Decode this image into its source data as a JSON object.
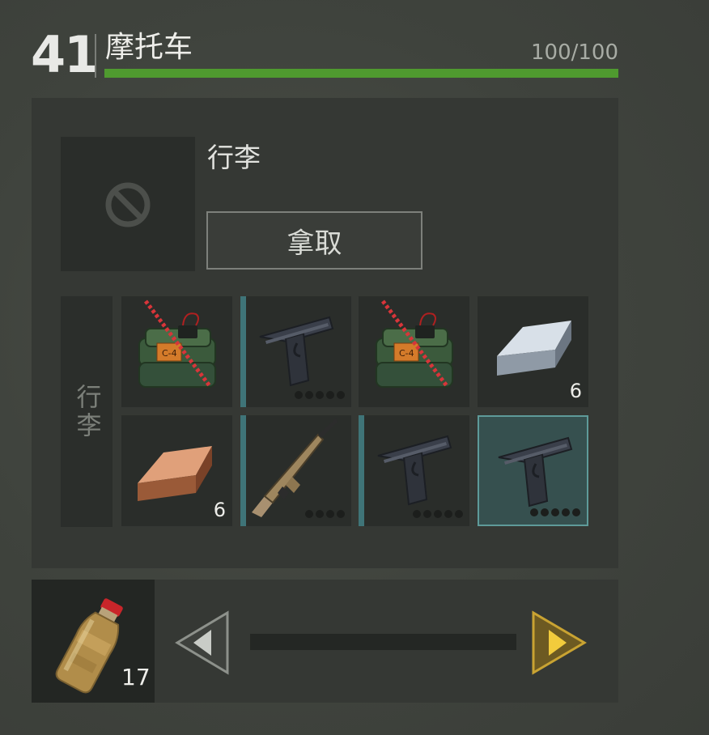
{
  "header": {
    "level": "41",
    "vehicle_name": "摩托车",
    "durability_text": "100/100",
    "durability_fraction": 1.0,
    "durability_color": "#4f9a2f"
  },
  "storage": {
    "slot_icon": "blocked-icon",
    "title": "行李",
    "take_label": "拿取",
    "side_label": "行李"
  },
  "items": [
    {
      "name": "c4-explosive",
      "icon": "c4-icon",
      "crossed": true,
      "count": "",
      "dots": 0,
      "bar": false,
      "selected": false
    },
    {
      "name": "pistol",
      "icon": "pistol-icon",
      "crossed": false,
      "count": "",
      "dots": 5,
      "bar": true,
      "selected": false
    },
    {
      "name": "c4-explosive",
      "icon": "c4-icon",
      "crossed": true,
      "count": "",
      "dots": 0,
      "bar": false,
      "selected": false
    },
    {
      "name": "iron-ingot",
      "icon": "iron-ingot-icon",
      "crossed": false,
      "count": "6",
      "dots": 0,
      "bar": false,
      "selected": false
    },
    {
      "name": "copper-ingot",
      "icon": "copper-ingot-icon",
      "crossed": false,
      "count": "6",
      "dots": 0,
      "bar": false,
      "selected": false
    },
    {
      "name": "assault-rifle",
      "icon": "rifle-icon",
      "crossed": false,
      "count": "",
      "dots": 4,
      "bar": true,
      "selected": false
    },
    {
      "name": "pistol",
      "icon": "pistol-icon",
      "crossed": false,
      "count": "",
      "dots": 5,
      "bar": true,
      "selected": false
    },
    {
      "name": "pistol",
      "icon": "pistol-icon",
      "crossed": false,
      "count": "",
      "dots": 5,
      "bar": false,
      "selected": true
    }
  ],
  "consumable": {
    "icon": "bottle-icon",
    "count": "17"
  },
  "nav": {
    "prev_icon": "arrow-left-icon",
    "next_icon": "arrow-right-icon",
    "next_color": "#c9a332"
  }
}
